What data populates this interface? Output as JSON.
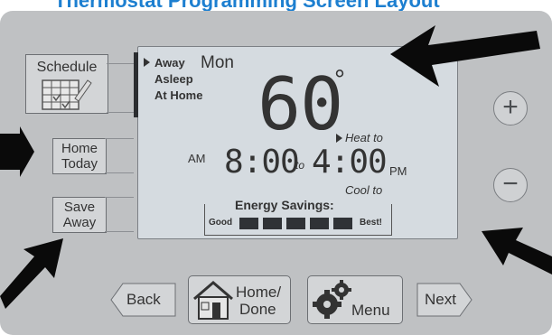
{
  "header_text": "Thermostat Programming Screen Layout",
  "side_buttons": {
    "schedule": "Schedule",
    "home_today_line1": "Home",
    "home_today_line2": "Today",
    "save_away_line1": "Save",
    "save_away_line2": "Away"
  },
  "display": {
    "modes": [
      "Away",
      "Asleep",
      "At Home"
    ],
    "day": "Mon",
    "temperature": "60",
    "degree": "°",
    "heat_label": "Heat to",
    "am_label": "AM",
    "start_time": "8:00",
    "to_label": "to",
    "end_time": "4:00",
    "pm_label": "PM",
    "cool_label": "Cool to",
    "energy_title": "Energy Savings:",
    "energy_low": "Good",
    "energy_high": "Best!",
    "energy_level_bars": 5
  },
  "round_buttons": {
    "plus": "+",
    "minus": "−"
  },
  "bottom_buttons": {
    "back": "Back",
    "home_done_line1": "Home/",
    "home_done_line2": "Done",
    "menu": "Menu",
    "next": "Next"
  },
  "colors": {
    "panel": "#bfc1c3",
    "screen": "#d5dbe0",
    "arrow": "#0a0a0a",
    "header": "#1d7fd0"
  }
}
